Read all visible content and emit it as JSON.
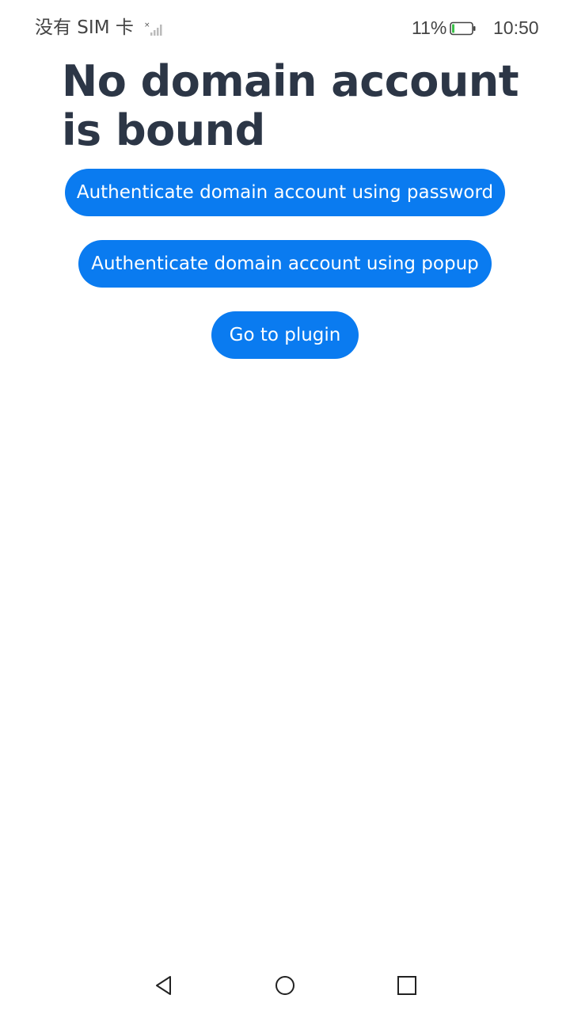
{
  "status_bar": {
    "carrier": "没有 SIM 卡",
    "battery_percent": "11%",
    "battery_level": 0.11,
    "time": "10:50",
    "icons": [
      "no-sim-signal-icon",
      "battery-icon"
    ]
  },
  "main": {
    "title": "No domain account is bound",
    "buttons": {
      "password": "Authenticate domain account using password",
      "popup": "Authenticate domain account using popup",
      "plugin": "Go to plugin"
    }
  },
  "nav_bar": {
    "icons": [
      "back-icon",
      "home-icon",
      "recent-apps-icon"
    ]
  },
  "colors": {
    "accent": "#0a7bf0",
    "title": "#2c3646",
    "background": "#ffffff",
    "battery_low": "#3cc24a"
  }
}
